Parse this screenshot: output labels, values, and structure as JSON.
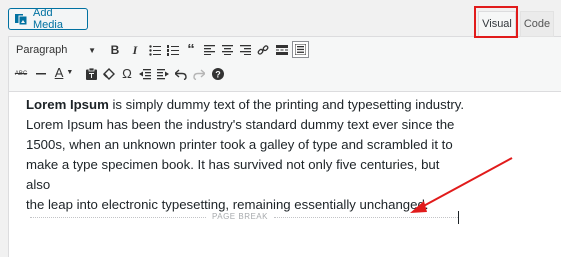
{
  "add_media": {
    "label": "Add Media",
    "icon": "media-icon"
  },
  "tabs": [
    {
      "label": "Visual",
      "active": true
    },
    {
      "label": "Code",
      "active": false
    }
  ],
  "toolbar": {
    "format_value": "Paragraph",
    "row1_icons": [
      "bold-icon",
      "italic-icon",
      "bulleted-list-icon",
      "numbered-list-icon",
      "blockquote-icon",
      "align-left-icon",
      "align-center-icon",
      "align-right-icon",
      "link-icon",
      "read-more-icon",
      "toolbar-toggle-icon"
    ],
    "row2_icons": [
      "strikethrough-icon",
      "horizontal-line-icon",
      "text-color-icon",
      "paste-as-text-icon",
      "clear-formatting-icon",
      "special-character-icon",
      "outdent-icon",
      "indent-icon",
      "undo-icon",
      "redo-icon",
      "help-icon"
    ]
  },
  "content": {
    "bold_lead": "Lorem Ipsum",
    "line1_rest": " is simply dummy text of the printing and typesetting industry.",
    "line2": "Lorem Ipsum has been the industry's standard dummy text ever since the",
    "line3": "1500s, when an unknown printer took a galley of type and scrambled it to",
    "line4": "make a type specimen book. It has survived not only five centuries, but also",
    "line5": "the leap into electronic typesetting, remaining essentially unchanged."
  },
  "page_break": {
    "label": "PAGE BREAK"
  },
  "annotation_color": "#e11b1b"
}
